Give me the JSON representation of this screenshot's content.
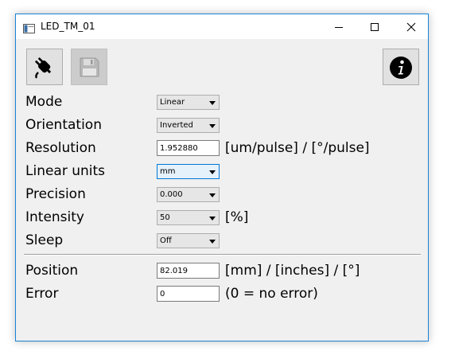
{
  "window": {
    "title": "LED_TM_01",
    "accent_color": "#1883d7"
  },
  "toolbar": {
    "connect_icon": "plug-icon",
    "save_icon": "floppy-disk-icon",
    "info_icon": "info-icon"
  },
  "settings": {
    "mode": {
      "label": "Mode",
      "value": "Linear"
    },
    "orientation": {
      "label": "Orientation",
      "value": "Inverted"
    },
    "resolution": {
      "label": "Resolution",
      "value": "1.952880",
      "unit": "[um/pulse] / [°/pulse]"
    },
    "linear_units": {
      "label": "Linear units",
      "value": "mm"
    },
    "precision": {
      "label": "Precision",
      "value": "0.000"
    },
    "intensity": {
      "label": "Intensity",
      "value": "50",
      "unit": "[%]"
    },
    "sleep": {
      "label": "Sleep",
      "value": "Off"
    }
  },
  "status": {
    "position": {
      "label": "Position",
      "value": "82.019",
      "unit": "[mm] / [inches] / [°]"
    },
    "error": {
      "label": "Error",
      "value": "0",
      "unit": "(0 = no error)"
    }
  }
}
